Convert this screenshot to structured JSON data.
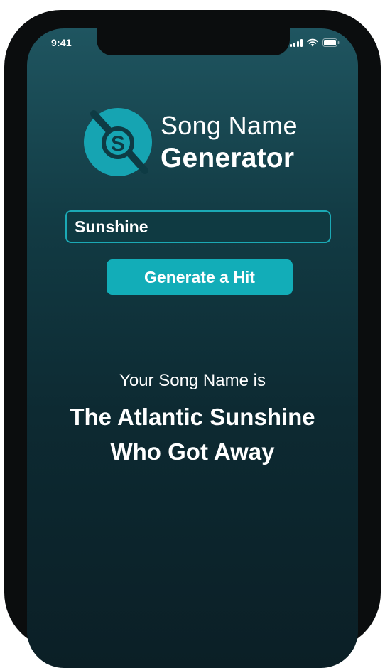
{
  "status_bar": {
    "time": "9:41",
    "icons": [
      "signal-icon",
      "wifi-icon",
      "battery-icon"
    ]
  },
  "header": {
    "logo_letter": "S",
    "title_line1": "Song Name",
    "title_line2": "Generator"
  },
  "form": {
    "input_value": "Sunshine",
    "button_label": "Generate a Hit"
  },
  "result": {
    "label": "Your Song Name is",
    "song_line1": "The Atlantic Sunshine",
    "song_line2": "Who Got Away"
  },
  "colors": {
    "accent": "#12adb8",
    "background_top": "#1f5560",
    "background_bottom": "#0b1f26",
    "text": "#ffffff"
  }
}
